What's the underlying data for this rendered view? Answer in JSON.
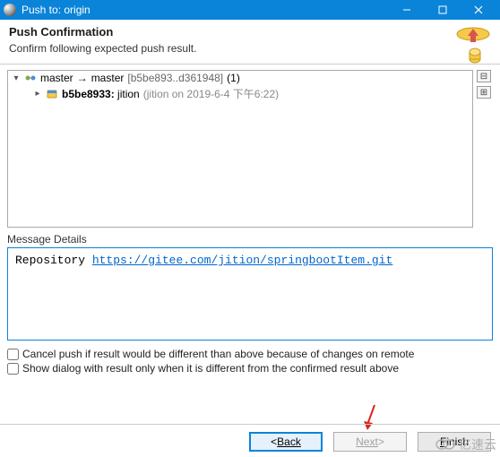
{
  "window": {
    "title": "Push to: origin"
  },
  "header": {
    "title": "Push Confirmation",
    "subtitle": "Confirm following expected push result."
  },
  "tree": {
    "branch_line": {
      "from": "master",
      "arrow": "→",
      "to": "master",
      "range": "[b5be893..d361948]",
      "count": "(1)"
    },
    "commit_line": {
      "hash": "b5be8933:",
      "message": "jition",
      "meta": "(jition on 2019-6-4 下午6:22)"
    }
  },
  "side_actions": {
    "collapse": "⊟",
    "expand": "⊞"
  },
  "message_details": {
    "label": "Message Details",
    "repo_prefix": "Repository ",
    "repo_url": "https://gitee.com/jition/springbootItem.git"
  },
  "checks": {
    "cancel": "Cancel push if result would be different than above because of changes on remote",
    "show_dialog": "Show dialog with result only when it is different from the confirmed result above"
  },
  "buttons": {
    "back_prefix": "< ",
    "back": "Back",
    "next": "Next",
    "next_suffix": " >",
    "finish": "Finish"
  },
  "watermark": {
    "text": "亿速云"
  }
}
